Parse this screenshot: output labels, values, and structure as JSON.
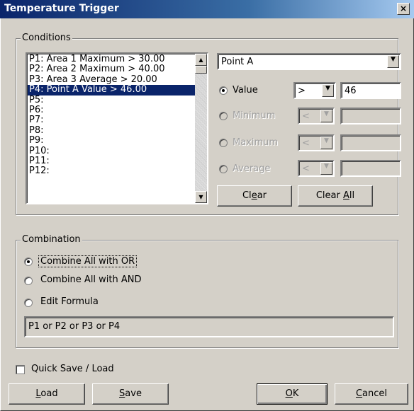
{
  "window": {
    "title": "Temperature Trigger",
    "close": "×"
  },
  "conditions": {
    "legend": "Conditions",
    "list": [
      "P1: Area 1 Maximum > 30.00",
      "P2: Area 2 Maximum > 40.00",
      "P3: Area 3 Average > 20.00",
      "P4: Point A Value > 46.00",
      "P5:",
      "P6:",
      "P7:",
      "P8:",
      "P9:",
      "P10:",
      "P11:",
      "P12:"
    ],
    "selected_index": 3,
    "source": "Point A",
    "value": {
      "label": "Value",
      "operator": ">",
      "input": "46"
    },
    "minimum": {
      "label": "Minimum",
      "operator": "<",
      "input": ""
    },
    "maximum": {
      "label": "Maximum",
      "operator": "<",
      "input": ""
    },
    "average": {
      "label": "Average",
      "operator": "<",
      "input": ""
    },
    "clear_prefix": "Cl",
    "clear_u": "e",
    "clear_suffix": "ar",
    "clearall_prefix": "Clear ",
    "clearall_u": "A",
    "clearall_suffix": "ll"
  },
  "combination": {
    "legend": "Combination",
    "or_label": "Combine All with OR",
    "and_label": "Combine All with AND",
    "formula_label": "Edit Formula",
    "formula": "P1 or P2 or P3 or P4"
  },
  "footer": {
    "quick_save": "Quick Save / Load",
    "load_u": "L",
    "load_rest": "oad",
    "save_u": "S",
    "save_rest": "ave",
    "ok_u": "O",
    "ok_rest": "K",
    "cancel_u": "C",
    "cancel_rest": "ancel"
  }
}
